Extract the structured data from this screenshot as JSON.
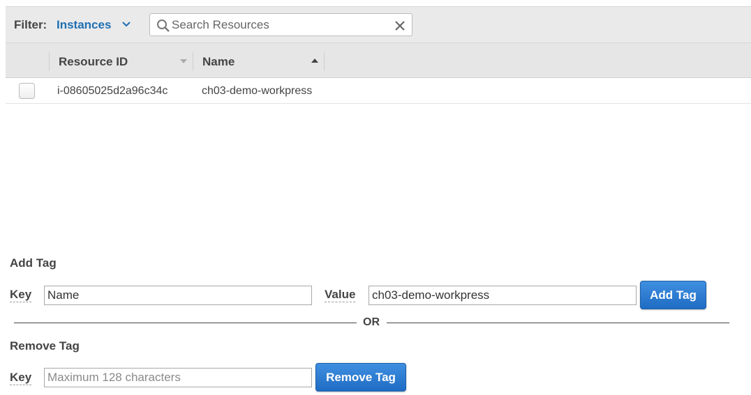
{
  "filter": {
    "label": "Filter:",
    "selected": "Instances",
    "search_placeholder": "Search Resources",
    "search_value": ""
  },
  "table": {
    "columns": [
      "Resource ID",
      "Name"
    ],
    "rows": [
      {
        "resource_id": "i-08605025d2a96c34c",
        "name": "ch03-demo-workpress"
      }
    ]
  },
  "add_tag": {
    "title": "Add Tag",
    "key_label": "Key",
    "key_value": "Name",
    "value_label": "Value",
    "value_value": "ch03-demo-workpress",
    "button_label": "Add Tag"
  },
  "divider_text": "OR",
  "remove_tag": {
    "title": "Remove Tag",
    "key_label": "Key",
    "key_placeholder": "Maximum 128 characters",
    "key_value": "",
    "button_label": "Remove Tag"
  },
  "colors": {
    "accent": "#1f6fb2",
    "button": "#2a7bd4",
    "header_bg": "#e6e6e6"
  }
}
